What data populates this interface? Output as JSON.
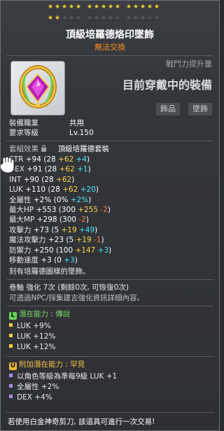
{
  "item": {
    "name": "頂級培羅德烙印墜飾",
    "trade_status": "無法交換",
    "icon": "purple-gem-pendant-icon",
    "star_rows": [
      [
        1,
        1,
        1,
        1,
        1,
        1,
        1,
        1,
        1,
        1,
        1,
        1,
        1,
        1,
        1
      ],
      [
        1,
        1,
        0,
        0,
        0,
        0,
        0,
        0,
        0,
        0,
        0,
        0,
        0,
        0,
        0
      ]
    ]
  },
  "combat": {
    "label": "戰鬥力提升量",
    "equipped_text": "目前穿戴中的裝備"
  },
  "categories": [
    "飾品",
    "墜飾"
  ],
  "requirements": [
    {
      "label": "裝備職業",
      "value": "共用"
    },
    {
      "label": "要求等級",
      "value": "Lv.150"
    }
  ],
  "set": {
    "label": "套組效果",
    "icon": "lock-icon",
    "name": "頂級培羅德套裝"
  },
  "stats": [
    {
      "label": "STR",
      "total": "+94",
      "parts": [
        {
          "t": "(28 ",
          "c": "w"
        },
        {
          "t": "+62",
          "c": "y"
        },
        {
          "t": " +4",
          "c": "c"
        },
        {
          "t": ")",
          "c": "w"
        }
      ]
    },
    {
      "label": "DEX",
      "total": "+91",
      "parts": [
        {
          "t": "(28 ",
          "c": "w"
        },
        {
          "t": "+62",
          "c": "y"
        },
        {
          "t": " +1",
          "c": "c"
        },
        {
          "t": ")",
          "c": "w"
        }
      ]
    },
    {
      "label": "INT",
      "total": "+90",
      "parts": [
        {
          "t": "(28 ",
          "c": "w"
        },
        {
          "t": "+62",
          "c": "y"
        },
        {
          "t": ")",
          "c": "w"
        }
      ]
    },
    {
      "label": "LUK",
      "total": "+110",
      "parts": [
        {
          "t": "(28 ",
          "c": "w"
        },
        {
          "t": "+62",
          "c": "y"
        },
        {
          "t": " +20",
          "c": "c"
        },
        {
          "t": ")",
          "c": "w"
        }
      ]
    },
    {
      "label": "全屬性",
      "total": "+2%",
      "parts": [
        {
          "t": "(0% ",
          "c": "w"
        },
        {
          "t": "+2%",
          "c": "c"
        },
        {
          "t": ")",
          "c": "w"
        }
      ]
    },
    {
      "label": "最大HP",
      "total": "+553",
      "parts": [
        {
          "t": "(300 ",
          "c": "w"
        },
        {
          "t": "+255",
          "c": "y"
        },
        {
          "t": " -2",
          "c": "r"
        },
        {
          "t": ")",
          "c": "w"
        }
      ]
    },
    {
      "label": "最大MP",
      "total": "+298",
      "parts": [
        {
          "t": "(300 ",
          "c": "w"
        },
        {
          "t": "-2",
          "c": "r"
        },
        {
          "t": ")",
          "c": "w"
        }
      ]
    },
    {
      "label": "攻擊力",
      "total": "+73",
      "parts": [
        {
          "t": "(5 ",
          "c": "w"
        },
        {
          "t": "+19",
          "c": "y"
        },
        {
          "t": " +49",
          "c": "c"
        },
        {
          "t": ")",
          "c": "w"
        }
      ]
    },
    {
      "label": "魔法攻擊力",
      "total": "+23",
      "parts": [
        {
          "t": "(5 ",
          "c": "w"
        },
        {
          "t": "+19",
          "c": "y"
        },
        {
          "t": " -1",
          "c": "r"
        },
        {
          "t": ")",
          "c": "w"
        }
      ]
    },
    {
      "label": "防禦力",
      "total": "+250",
      "parts": [
        {
          "t": "(100 ",
          "c": "w"
        },
        {
          "t": "+147",
          "c": "y"
        },
        {
          "t": " +3",
          "c": "c"
        },
        {
          "t": ")",
          "c": "w"
        }
      ]
    },
    {
      "label": "移動速度",
      "total": "+3",
      "parts": [
        {
          "t": "(0 ",
          "c": "w"
        },
        {
          "t": "+3",
          "c": "c"
        },
        {
          "t": ")",
          "c": "w"
        }
      ]
    }
  ],
  "description": "刻有培羅德圖樣的墜飾。",
  "scroll": {
    "line1": "卷軸 強化 7次 (剩餘0次, 可恢復0次)",
    "line2": "可透過NPC/採集建言強化資訊詳細內容。"
  },
  "potential": {
    "badge": "L",
    "label": "潛在能力 : 傳說",
    "lines": [
      "LUK +9%",
      "LUK +12%",
      "LUK +12%"
    ]
  },
  "bonus_potential": {
    "badge": "U",
    "label": "附加潛在能力 : 罕見",
    "lines": [
      "以角色等級為準每9級 LUK +1",
      "全屬性 +2%",
      "DEX +4%"
    ]
  },
  "footer": "若使用白金神奇剪刀, 該道具可進行一次交易!",
  "colors": {
    "star_on": "#f3cf2e",
    "title_orange": "#ff8f1a",
    "bonus_yellow": "#ffd54a",
    "bonus_cyan": "#4ae8ff",
    "legend_green": "#6ad35a",
    "unique_gold": "#f0b63a"
  }
}
